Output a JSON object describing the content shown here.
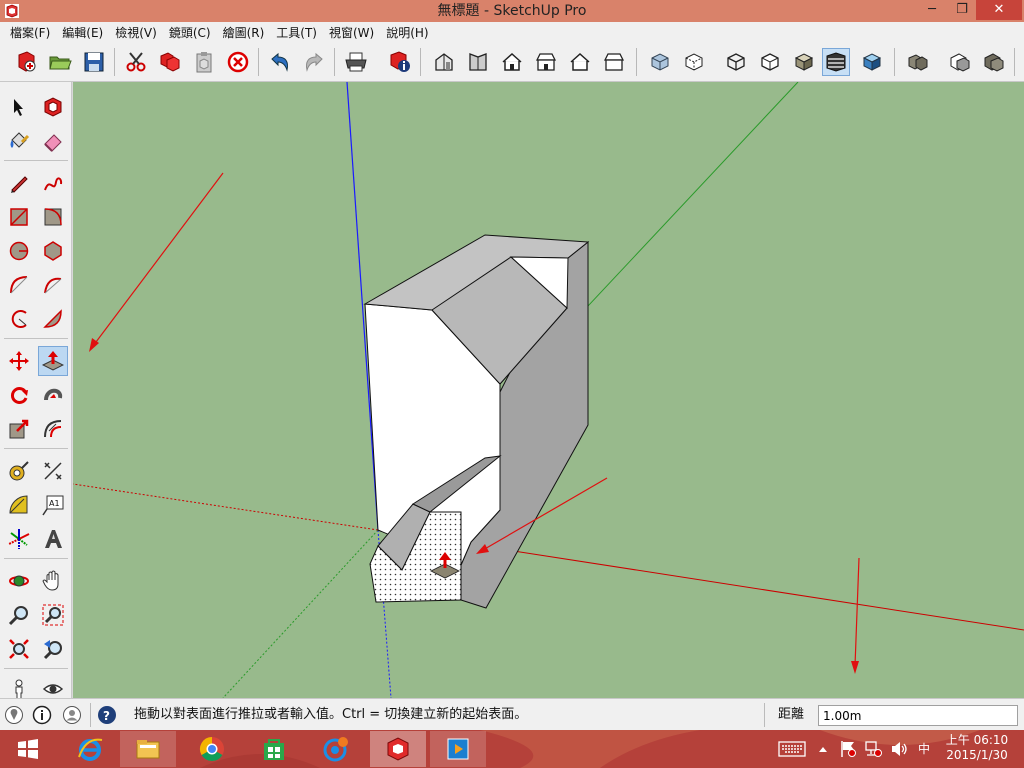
{
  "window": {
    "title": "無標題 - SketchUp Pro",
    "minimize_glyph": "─",
    "restore_glyph": "❐",
    "close_glyph": "✕"
  },
  "menu": [
    {
      "label": "檔案(F)"
    },
    {
      "label": "編輯(E)"
    },
    {
      "label": "檢視(V)"
    },
    {
      "label": "鏡頭(C)"
    },
    {
      "label": "繪圖(R)"
    },
    {
      "label": "工具(T)"
    },
    {
      "label": "視窗(W)"
    },
    {
      "label": "說明(H)"
    }
  ],
  "toolbar_icons": [
    "new-model-icon",
    "open-folder-icon",
    "save-icon",
    "cut-icon",
    "copy-icon",
    "paste-icon",
    "erase-icon",
    "undo-icon",
    "redo-icon",
    "print-icon",
    "model-info-icon",
    "iso-view-icon",
    "top-view-icon",
    "front-view-icon",
    "right-view-icon",
    "back-view-icon",
    "left-view-icon",
    "xray-icon",
    "back-edges-icon",
    "wireframe-icon",
    "hidden-line-icon",
    "shaded-icon",
    "shaded-textures-icon",
    "monochrome-icon",
    "components-icon",
    "section-plane-icon",
    "section-cut-icon"
  ],
  "left_tools": [
    "select-tool-icon",
    "make-component-icon",
    "paint-bucket-icon",
    "eraser-icon",
    "line-tool-icon",
    "freehand-tool-icon",
    "rectangle-tool-icon",
    "rotated-rectangle-icon",
    "circle-tool-icon",
    "polygon-tool-icon",
    "arc-tool-icon",
    "two-point-arc-icon",
    "three-point-arc-icon",
    "pie-tool-icon",
    "move-tool-icon",
    "push-pull-tool-icon",
    "rotate-tool-icon",
    "follow-me-tool-icon",
    "scale-tool-icon",
    "offset-tool-icon",
    "tape-measure-icon",
    "dimension-tool-icon",
    "protractor-icon",
    "text-tool-icon",
    "axes-tool-icon",
    "3d-text-icon",
    "orbit-tool-icon",
    "pan-tool-icon",
    "zoom-tool-icon",
    "zoom-window-icon",
    "zoom-extents-icon",
    "previous-view-icon",
    "position-camera-icon",
    "look-around-icon"
  ],
  "status": {
    "hint": "拖動以對表面進行推拉或者輸入值。Ctrl = 切換建立新的起始表面。",
    "measurement_label": "距離",
    "measurement_value": "1.00m"
  },
  "taskbar": {
    "apps": [
      "start-icon",
      "internet-explorer-icon",
      "file-explorer-icon",
      "chrome-icon",
      "store-icon",
      "screen-capture-icon",
      "sketchup-icon",
      "media-player-icon"
    ],
    "ime": "中",
    "time": "上午 06:10",
    "date": "2015/1/30"
  },
  "colors": {
    "title_bar": "#d9826a",
    "viewport_bg": "#98ba8c",
    "taskbar": "#b5413a",
    "axis_red": "#cc0000",
    "axis_green": "#2a9a2a",
    "axis_blue": "#1a1aff"
  }
}
